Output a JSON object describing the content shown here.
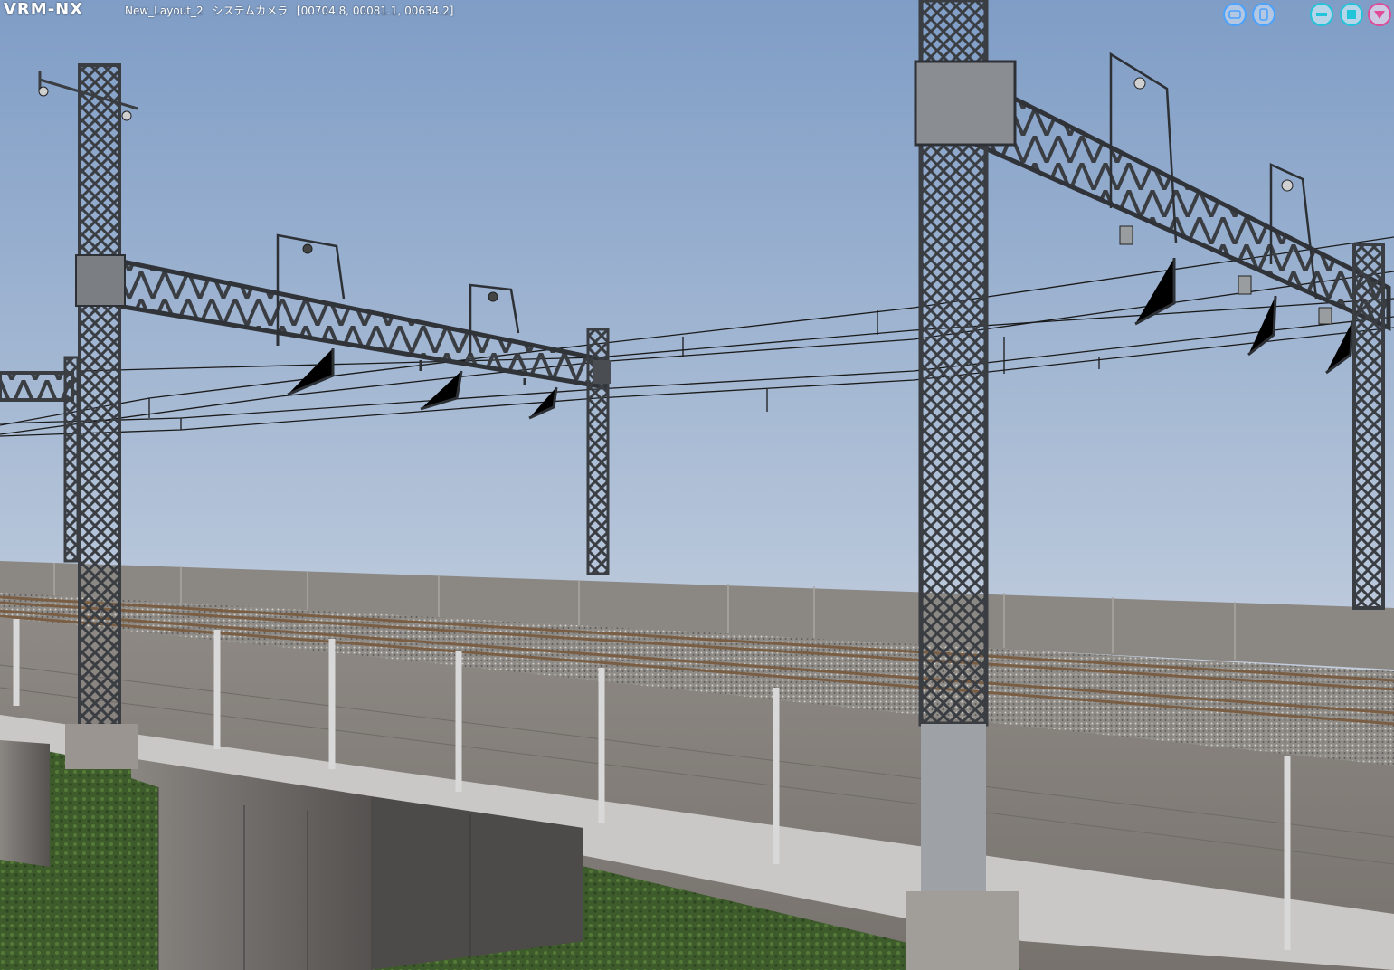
{
  "app": {
    "logo": "VRM-NX",
    "layout_name": "New_Layout_2",
    "camera_name": "システムカメラ",
    "camera_coords": "[00704.8, 00081.1, 00634.2]"
  },
  "window_controls": [
    {
      "name": "layout-toggle-1-button",
      "icon": "panel-icon",
      "color": "#4aa3ff"
    },
    {
      "name": "layout-toggle-2-button",
      "icon": "panel-icon",
      "color": "#4aa3ff"
    },
    {
      "name": "minimize-button",
      "icon": "minus-icon",
      "color": "#21c4d9"
    },
    {
      "name": "maximize-button",
      "icon": "square-icon",
      "color": "#21c4d9"
    },
    {
      "name": "menu-button",
      "icon": "triangle-down-icon",
      "color": "#e04b9a"
    }
  ],
  "scene": {
    "description_colors": {
      "sky_top": "#7f9dc6",
      "sky_bottom": "#e6e3ec",
      "grass": "#3e5b2c",
      "concrete": "#8a8580",
      "steel": "#4a4d52",
      "rail": "#7a5e44"
    }
  }
}
